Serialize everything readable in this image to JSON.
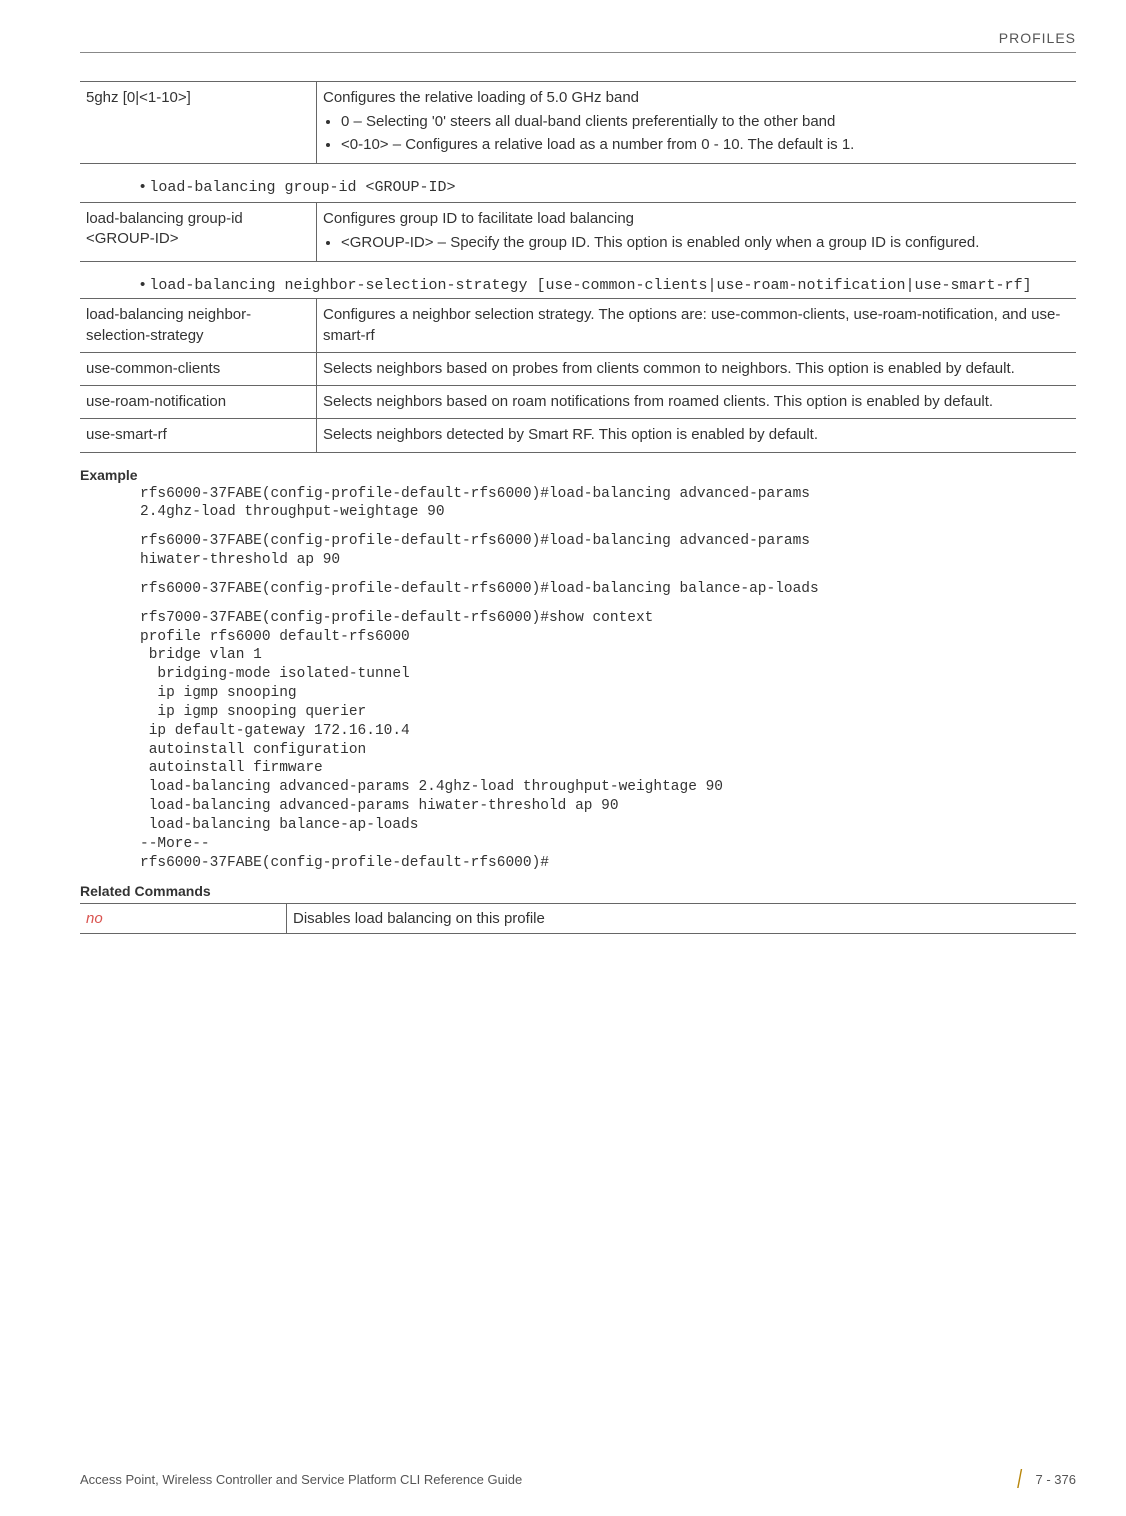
{
  "header": {
    "section": "PROFILES"
  },
  "tables": {
    "t1": {
      "r1c1": "5ghz [0|<1-10>]",
      "r1c2_line1": "Configures the relative loading of 5.0 GHz band",
      "r1c2_li1": "0 – Selecting '0' steers all dual-band clients preferentially to the other band",
      "r1c2_li2": "<0-10> – Configures a relative load as a number from 0 - 10. The default is 1."
    },
    "t2": {
      "r1c1": "load-balancing group-id <GROUP-ID>",
      "r1c2_line1": "Configures group ID to facilitate load balancing",
      "r1c2_li1": "<GROUP-ID> – Specify the group ID. This option is enabled only when a group ID is configured."
    },
    "t3": {
      "r1c1": "load-balancing neighbor-selection-strategy",
      "r1c2": "Configures a neighbor selection strategy. The options are: use-common-clients, use-roam-notification, and use-smart-rf",
      "r2c1": "use-common-clients",
      "r2c2": "Selects neighbors based on probes from clients common to neighbors. This option is enabled by default.",
      "r3c1": "use-roam-notification",
      "r3c2": "Selects neighbors based on roam notifications from roamed clients. This option is enabled by default.",
      "r4c1": "use-smart-rf",
      "r4c2": "Selects neighbors detected by Smart RF. This option is enabled by default."
    },
    "related": {
      "r1c1": "no",
      "r1c2": "Disables load balancing on this profile"
    }
  },
  "bullets": {
    "b1": "load-balancing group-id <GROUP-ID>",
    "b2": "load-balancing neighbor-selection-strategy [use-common-clients|use-roam-notification|use-smart-rf]"
  },
  "labels": {
    "example": "Example",
    "related": "Related Commands"
  },
  "example": {
    "block1": "rfs6000-37FABE(config-profile-default-rfs6000)#load-balancing advanced-params \n2.4ghz-load throughput-weightage 90",
    "block2": "rfs6000-37FABE(config-profile-default-rfs6000)#load-balancing advanced-params \nhiwater-threshold ap 90",
    "block3": "rfs6000-37FABE(config-profile-default-rfs6000)#load-balancing balance-ap-loads",
    "block4a": "rfs7000-37FABE(config-profile-default-rfs6000)#show context\nprofile rfs6000 default-rfs6000\n bridge vlan 1\n  bridging-mode isolated-tunnel\n  ip igmp snooping\n  ip igmp snooping querier\n ip default-gateway 172.16.10.4\n autoinstall configuration\n autoinstall firmware",
    "block4b": " load-balancing advanced-params 2.4ghz-load throughput-weightage 90\n load-balancing advanced-params hiwater-threshold ap 90\n load-balancing balance-ap-loads",
    "block4c": "--More--\nrfs6000-37FABE(config-profile-default-rfs6000)#"
  },
  "footer": {
    "left": "Access Point, Wireless Controller and Service Platform CLI Reference Guide",
    "page": "7 - 376"
  }
}
